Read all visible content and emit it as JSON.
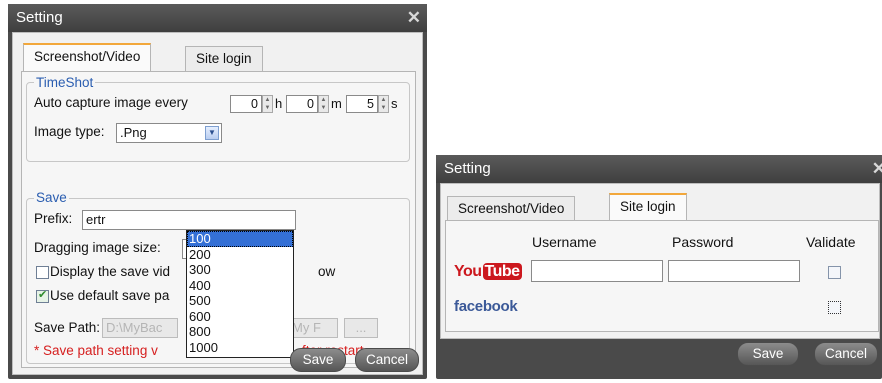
{
  "left_dialog": {
    "title": "Setting",
    "close_symbol": "✕",
    "tabs": [
      {
        "label": "Screenshot/Video",
        "active": true
      },
      {
        "label": "Site login",
        "active": false
      }
    ],
    "timeshot": {
      "legend": "TimeShot",
      "auto_capture_label": "Auto capture image every",
      "hours_value": "0",
      "hours_unit": "h",
      "minutes_value": "0",
      "minutes_unit": "m",
      "seconds_value": "5",
      "seconds_unit": "s",
      "image_type_label": "Image type:",
      "image_type_value": ".Png"
    },
    "save": {
      "legend": "Save",
      "prefix_label": "Prefix:",
      "prefix_value": "ertr",
      "dragging_label": "Dragging image size:",
      "dragging_value": "100",
      "display_label_left": "Display the save vid",
      "display_label_right": "ow",
      "use_default_label": "Use default save pa",
      "use_default_checked": true,
      "save_path_label": "Save Path:",
      "save_path_value": "D:\\MyBac",
      "save_path_value_right": "My F",
      "browse_label": "...",
      "note_left": "* Save path setting v",
      "note_right": "fter restart."
    },
    "dropdown_options": [
      "100",
      "200",
      "300",
      "400",
      "500",
      "600",
      "800",
      "1000"
    ],
    "dropdown_selected": "100",
    "save_button": "Save",
    "cancel_button": "Cancel"
  },
  "right_dialog": {
    "title": "Setting",
    "close_symbol": "✕",
    "tabs": [
      {
        "label": "Screenshot/Video",
        "active": false
      },
      {
        "label": "Site login",
        "active": true
      }
    ],
    "columns": {
      "username": "Username",
      "password": "Password",
      "validate": "Validate"
    },
    "sites": [
      {
        "logo_you": "You",
        "logo_tube": "Tube"
      },
      {
        "logo": "facebook"
      }
    ],
    "save_button": "Save",
    "cancel_button": "Cancel"
  },
  "colors": {
    "accent_tab": "#f2a73b",
    "legend_blue": "#2a5db0",
    "note_red": "#d62020",
    "youtube_red": "#cc181e",
    "facebook_blue": "#3b5998"
  }
}
